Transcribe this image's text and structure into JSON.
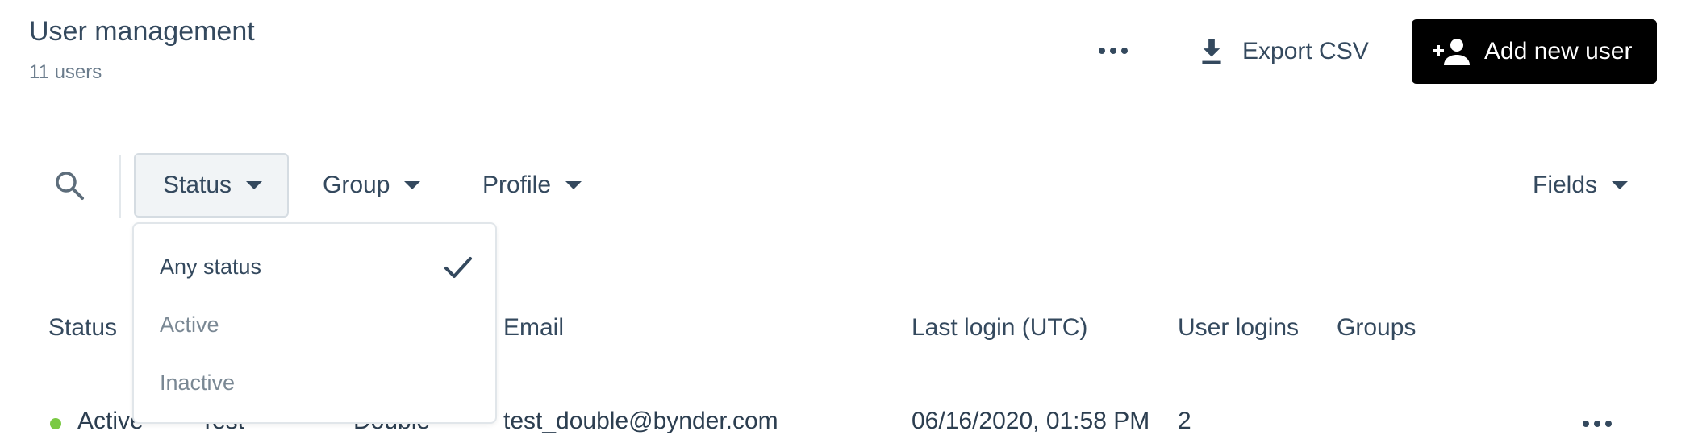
{
  "header": {
    "title": "User management",
    "subtitle": "11 users",
    "more_icon": "more-horizontal-icon",
    "export_label": "Export CSV",
    "export_icon": "download-icon",
    "add_label": "Add new user",
    "add_icon": "person-add-icon"
  },
  "filters": {
    "search_icon": "search-icon",
    "status_label": "Status",
    "group_label": "Group",
    "profile_label": "Profile",
    "fields_label": "Fields"
  },
  "status_dropdown": {
    "options": [
      "Any status",
      "Active",
      "Inactive"
    ],
    "selected": "Any status"
  },
  "table": {
    "headers": {
      "status": "Status",
      "email": "Email",
      "last_login": "Last login (UTC)",
      "user_logins": "User logins",
      "groups": "Groups"
    },
    "rows": [
      {
        "status": "Active",
        "first_name": "Test",
        "last_name": "Double",
        "email": "test_double@bynder.com",
        "last_login": "06/16/2020, 01:58 PM",
        "user_logins": "2"
      }
    ]
  },
  "colors": {
    "primary_button": "#000000",
    "active_status": "#7ac943",
    "text": "#34495e",
    "muted": "#7a8894"
  }
}
